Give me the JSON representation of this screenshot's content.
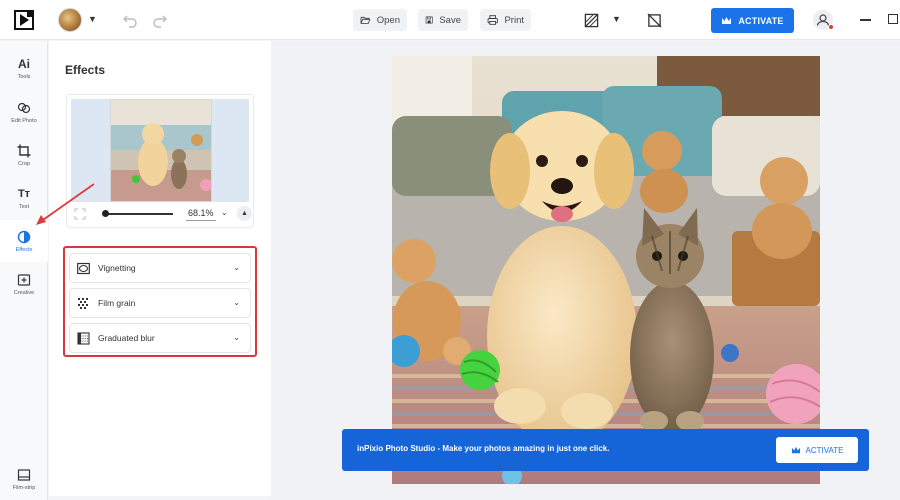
{
  "toolbar": {
    "open_label": "Open",
    "save_label": "Save",
    "print_label": "Print",
    "activate_label": "ACTIVATE",
    "accent_color": "#1a73e8"
  },
  "sidebar": {
    "items": [
      {
        "label": "Tools",
        "icon": "ai-icon"
      },
      {
        "label": "Edit Photo",
        "icon": "edit-photo-icon"
      },
      {
        "label": "Crop",
        "icon": "crop-icon"
      },
      {
        "label": "Text",
        "icon": "text-icon"
      },
      {
        "label": "Effects",
        "icon": "effects-icon",
        "active": true
      },
      {
        "label": "Creative",
        "icon": "creative-icon"
      }
    ],
    "bottom": {
      "label": "Film-strip",
      "icon": "film-strip-icon"
    }
  },
  "panel": {
    "title": "Effects",
    "zoom": "68.1%",
    "effects": [
      {
        "label": "Vignetting",
        "icon": "vignetting-icon"
      },
      {
        "label": "Film grain",
        "icon": "film-grain-icon"
      },
      {
        "label": "Graduated blur",
        "icon": "graduated-blur-icon"
      }
    ]
  },
  "banner": {
    "text": "inPixio Photo Studio - Make your photos amazing in just one click.",
    "button_label": "ACTIVATE",
    "color": "#1565d8"
  }
}
